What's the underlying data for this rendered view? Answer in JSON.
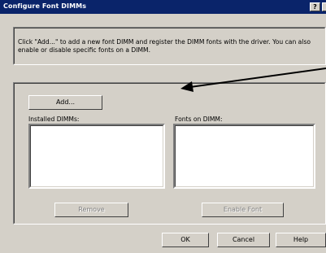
{
  "window": {
    "title": "Configure Font DIMMs",
    "help_glyph": "?"
  },
  "description": "Click \"Add...\" to add a new font DIMM and register the DIMM fonts with the driver.  You can also enable or disable specific fonts on a DIMM.",
  "add_button": "Add...",
  "installed_label": "Installed DIMMs:",
  "fonts_label": "Fonts on DIMM:",
  "remove_button": "Remove",
  "enable_font_button": "Enable Font",
  "footer": {
    "ok": "OK",
    "cancel": "Cancel",
    "help": "Help"
  }
}
